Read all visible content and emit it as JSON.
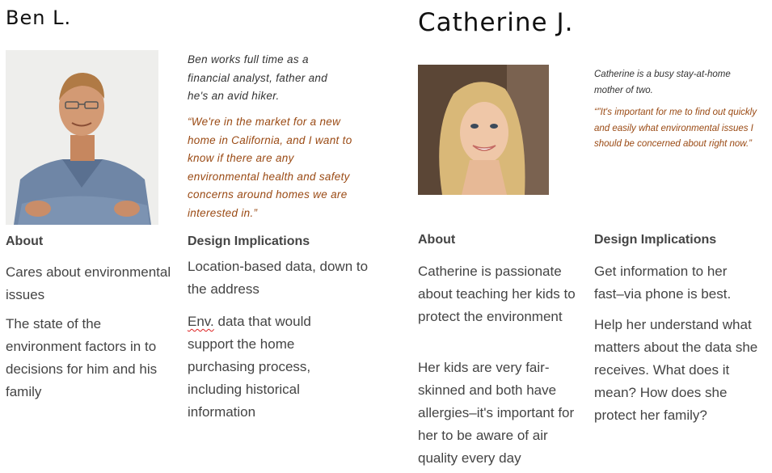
{
  "ben": {
    "name": "Ben L.",
    "intro": "Ben works full time as a financial analyst, father and he's an avid hiker.",
    "quote": "“We're in the market for a new home in California, and I want to know if there are any environmental health and safety concerns around homes we are interested in.”",
    "about_heading": "About",
    "about": [
      "Cares about environmental issues",
      "The state of the environment factors in to decisions for him and his family"
    ],
    "design_heading": "Design Implications",
    "design_1": "Location-based data, down to the address",
    "design_2_abbrev": "Env.",
    "design_2_rest": " data that would support the home purchasing process, including historical information"
  },
  "catherine": {
    "name": "Catherine J.",
    "intro": "Catherine is a busy stay-at-home mother of two.",
    "quote": "“”It's important for me to find out quickly and easily what environmental issues I should be concerned about right now.”",
    "about_heading": "About",
    "about": [
      "Catherine is passionate about teaching her kids to protect the environment",
      "Her kids are very fair-skinned and both have allergies–it's important for her to be aware of air quality every day"
    ],
    "design_heading": "Design Implications",
    "design": [
      "Get information to her fast–via phone is best.",
      "Help her understand what matters about the data she receives. What does it mean? How does she protect her family?"
    ]
  }
}
